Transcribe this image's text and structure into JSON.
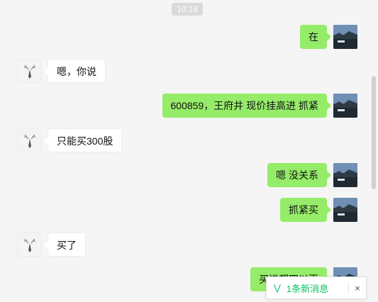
{
  "time_label": "10:16",
  "messages": [
    {
      "from": "self",
      "text": "在"
    },
    {
      "from": "other",
      "text": "嗯，你说"
    },
    {
      "from": "self",
      "text": "600859，王府井   现价挂高进  抓紧"
    },
    {
      "from": "other",
      "text": "只能买300股"
    },
    {
      "from": "self",
      "text": "嗯 没关系"
    },
    {
      "from": "self",
      "text": "抓紧买"
    },
    {
      "from": "other",
      "text": "买了"
    },
    {
      "from": "self",
      "text": "买进都四以再"
    }
  ],
  "new_message_notice": {
    "icon": "double-chevron-down-icon",
    "label": "1条新消息",
    "close_glyph": "×"
  },
  "colors": {
    "background": "#f5f5f5",
    "self_bubble": "#95ec69",
    "other_bubble": "#ffffff",
    "accent": "#07c160"
  }
}
